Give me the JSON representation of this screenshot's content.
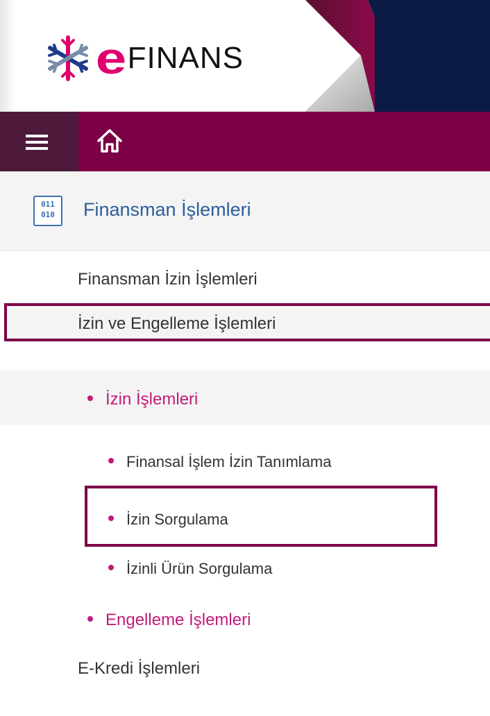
{
  "brand": {
    "logo_letter": "e",
    "logo_word": "FINANS",
    "icon": "snowflake-logo-icon",
    "colors": {
      "accent": "#df006e",
      "primary": "#7c0046",
      "navy": "#0a1a45",
      "link": "#2c5d9c"
    }
  },
  "topbar": {
    "menu_icon": "hamburger-menu-icon",
    "home_icon": "home-icon"
  },
  "section": {
    "icon": "binary-icon",
    "icon_bits": [
      "011",
      "010"
    ],
    "title": "Finansman İşlemleri"
  },
  "nav": {
    "items": [
      {
        "label": "Finansman İzin İşlemleri"
      },
      {
        "label": "İzin ve Engelleme İşlemleri"
      }
    ],
    "sub_group": {
      "label": "İzin İşlemleri",
      "leaves": [
        {
          "label": "Finansal İşlem İzin Tanımlama"
        },
        {
          "label": "İzin Sorgulama"
        },
        {
          "label": "İzinli Ürün Sorgulama"
        }
      ]
    },
    "second_group": {
      "label": "Engelleme İşlemleri"
    },
    "last_item": {
      "label": "E-Kredi İşlemleri"
    }
  }
}
